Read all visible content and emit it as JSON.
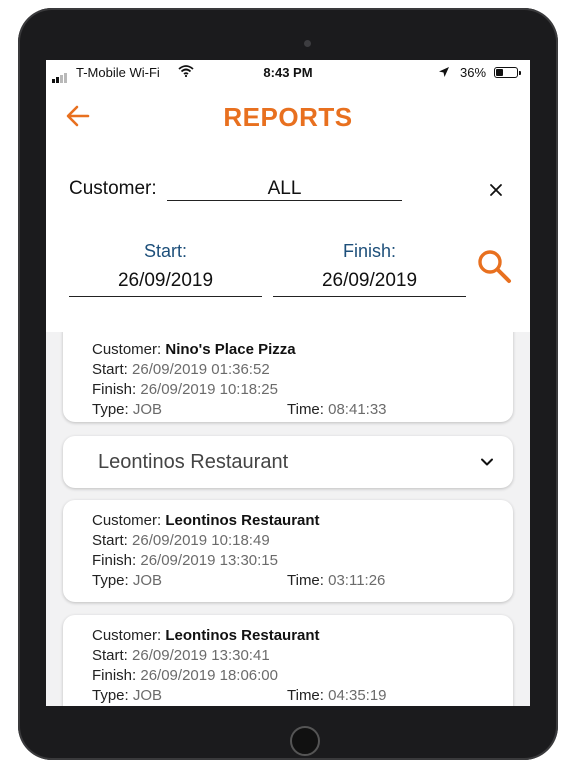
{
  "status_bar": {
    "carrier": "T-Mobile Wi-Fi",
    "time": "8:43 PM",
    "battery": "36%",
    "battery_level": 0.36
  },
  "header": {
    "title": "REPORTS",
    "back_icon": "arrow-left-icon",
    "accent_color": "#e8701f"
  },
  "filters": {
    "customer_label": "Customer:",
    "customer_value": "ALL",
    "clear_icon": "close-icon",
    "start_label": "Start:",
    "start_value": "26/09/2019",
    "finish_label": "Finish:",
    "finish_value": "26/09/2019",
    "search_icon": "search-icon",
    "label_color": "#1d4f7a"
  },
  "labels": {
    "customer": "Customer:",
    "start": "Start:",
    "finish": "Finish:",
    "type": "Type:",
    "time": "Time:"
  },
  "entries": [
    {
      "customer": "Nino's Place Pizza",
      "start": "26/09/2019 01:36:52",
      "finish": "26/09/2019 10:18:25",
      "type": "JOB",
      "time": "08:41:33"
    },
    {
      "customer": "Leontinos Restaurant",
      "start": "26/09/2019 10:18:49",
      "finish": "26/09/2019 13:30:15",
      "type": "JOB",
      "time": "03:11:26"
    },
    {
      "customer": "Leontinos Restaurant",
      "start": "26/09/2019 13:30:41",
      "finish": "26/09/2019 18:06:00",
      "type": "JOB",
      "time": "04:35:19"
    }
  ],
  "group": {
    "name": "Leontinos Restaurant",
    "chevron_icon": "chevron-down-icon"
  }
}
